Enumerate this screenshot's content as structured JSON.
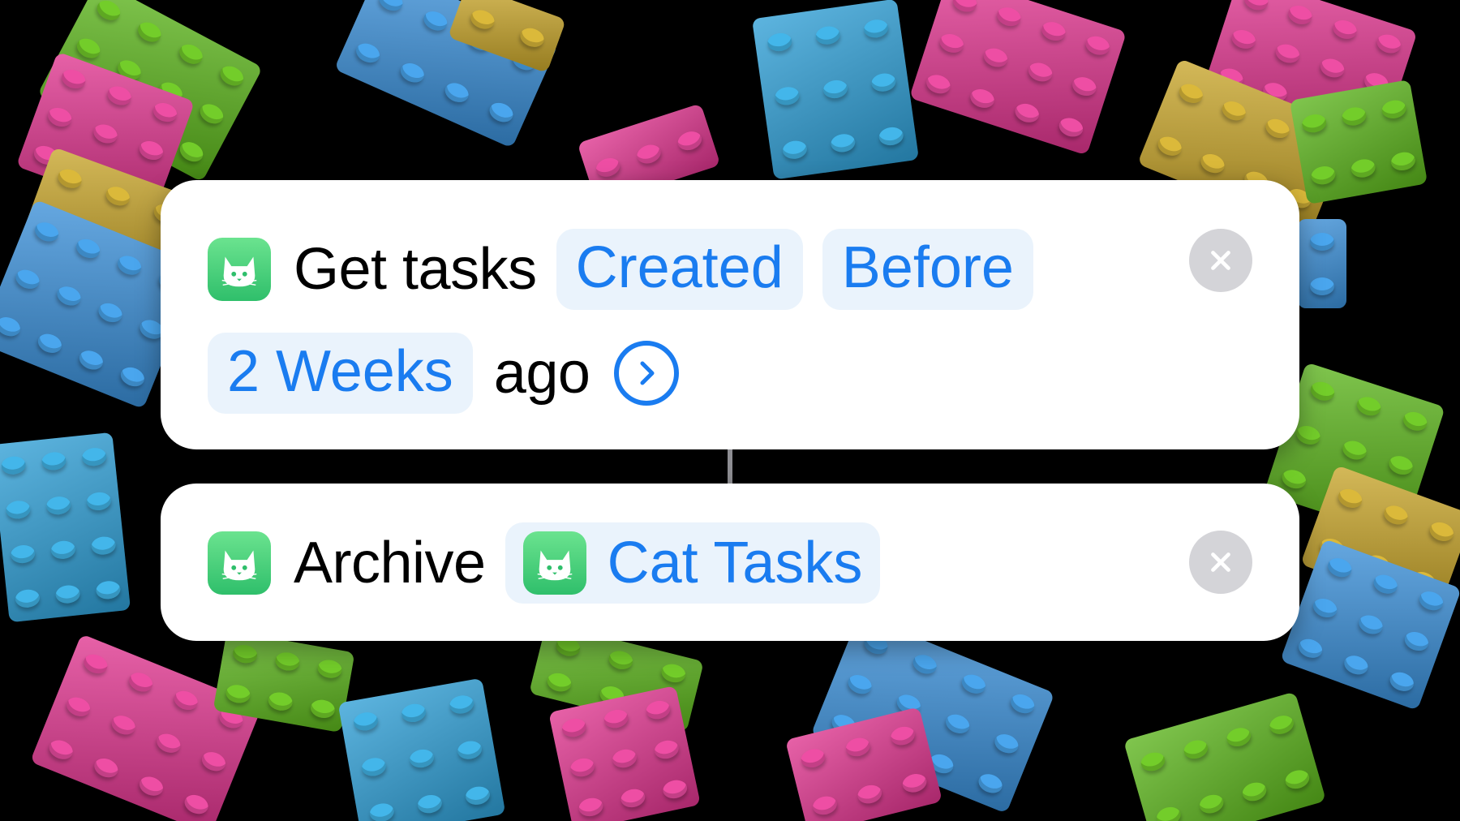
{
  "colors": {
    "accent": "#1a7cf0",
    "token_bg": "#eaf3fc",
    "card_bg": "#ffffff",
    "app_icon": "#3ccf78",
    "close_bg": "#d4d4d8"
  },
  "actions": [
    {
      "app_icon": "cat-app-icon",
      "verb": "Get tasks",
      "params": [
        "Created",
        "Before",
        "2 Weeks"
      ],
      "suffix": "ago",
      "expand_icon": "chevron-right-circle-icon",
      "remove_icon": "close-icon"
    },
    {
      "app_icon": "cat-app-icon",
      "verb": "Archive",
      "param_icon": "cat-app-icon",
      "param": "Cat Tasks",
      "remove_icon": "close-icon"
    }
  ]
}
